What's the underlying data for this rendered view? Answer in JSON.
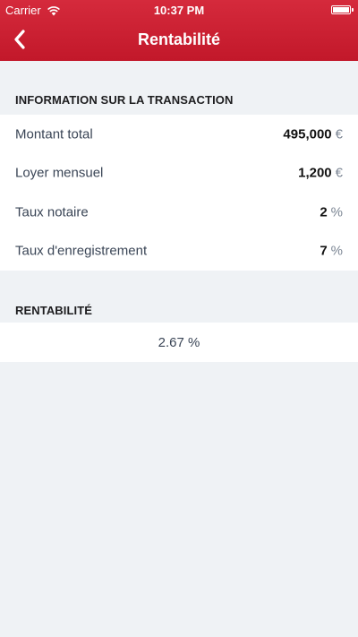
{
  "status_bar": {
    "carrier": "Carrier",
    "time": "10:37 PM"
  },
  "nav": {
    "title": "Rentabilité",
    "back_icon": "chevron-left-icon"
  },
  "transaction": {
    "header": "INFORMATION SUR LA TRANSACTION",
    "rows": [
      {
        "label": "Montant total",
        "value": "495,000",
        "unit": "€"
      },
      {
        "label": "Loyer mensuel",
        "value": "1,200",
        "unit": "€"
      },
      {
        "label": "Taux notaire",
        "value": "2",
        "unit": "%"
      },
      {
        "label": "Taux d'enregistrement",
        "value": "7",
        "unit": "%"
      }
    ]
  },
  "rentabilite": {
    "header": "RENTABILITÉ",
    "value": "2.67 %"
  },
  "colors": {
    "nav_background": "#c8202f",
    "page_background": "#eff2f5",
    "label_text": "#3a4556"
  }
}
